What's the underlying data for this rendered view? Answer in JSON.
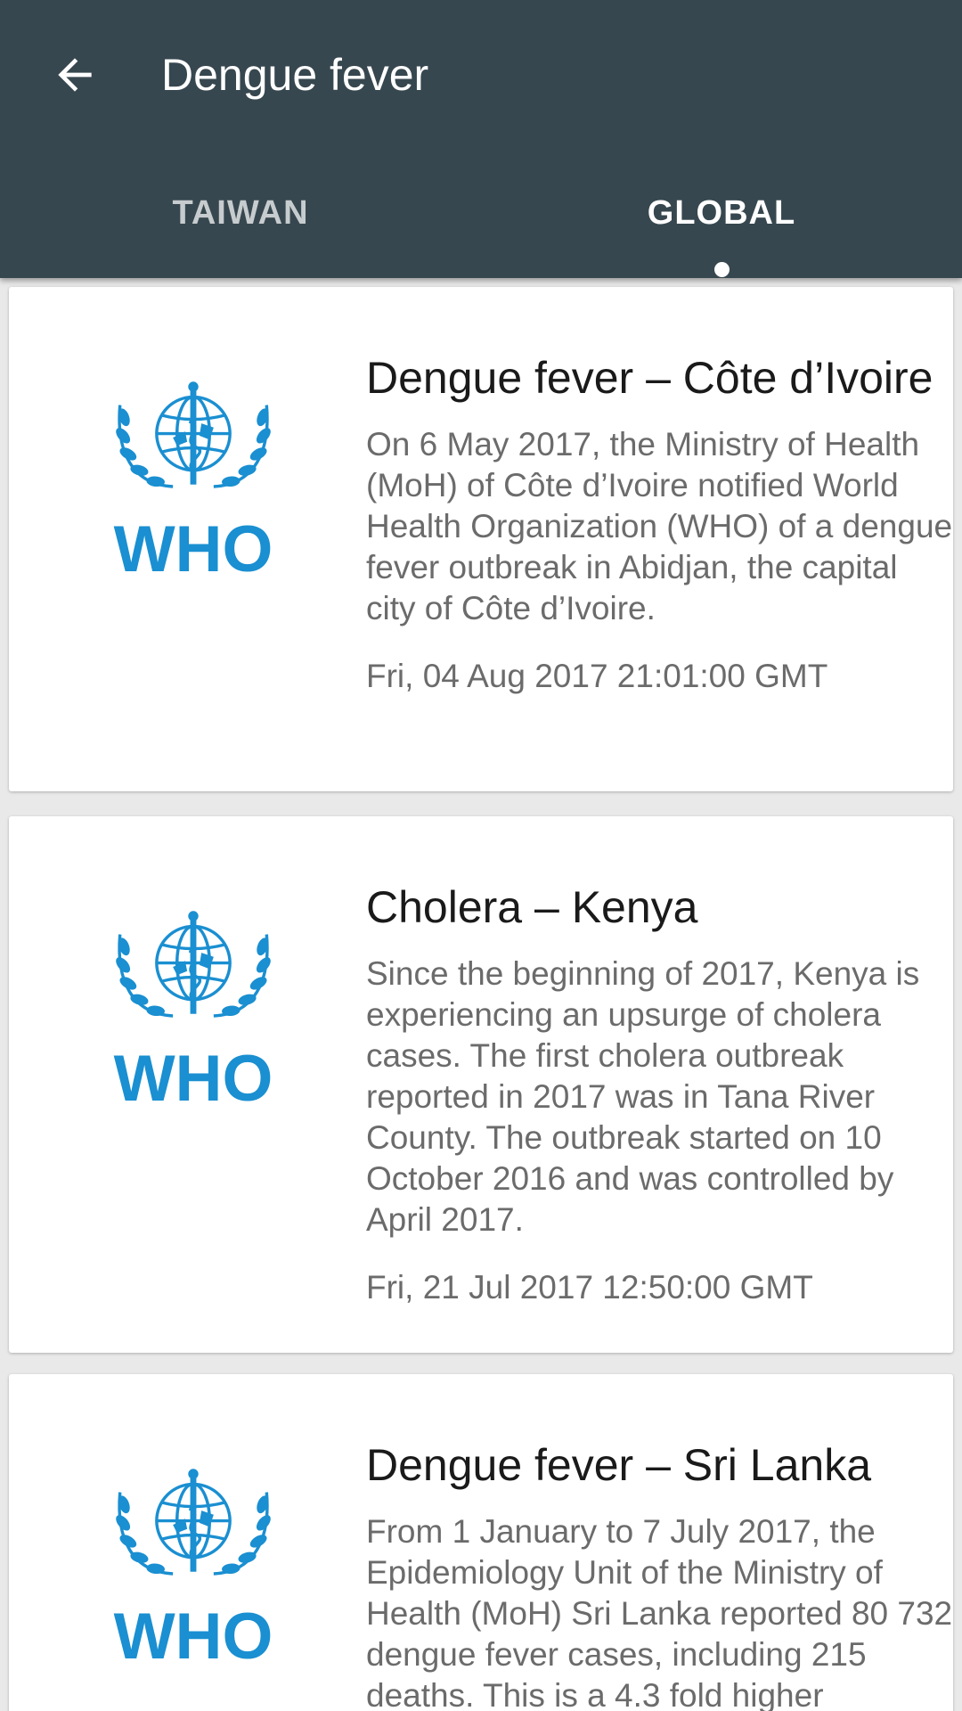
{
  "appbar": {
    "title": "Dengue fever",
    "tabs": [
      {
        "label": "TAIWAN",
        "active": false
      },
      {
        "label": "GLOBAL",
        "active": true
      }
    ]
  },
  "colors": {
    "appbar": "#37474f",
    "who_blue": "#1a8fd1"
  },
  "icons": {
    "back": "arrow-back-icon",
    "logo": "who-logo"
  },
  "logo_text": "WHO",
  "cards": [
    {
      "title": "Dengue fever – Côte d’Ivoire",
      "body": "On 6 May 2017, the Ministry of Health (MoH) of Côte d’Ivoire notified World Health Organization (WHO) of a dengue fever outbreak in Abidjan, the capital city of Côte d’Ivoire.",
      "date": "Fri, 04 Aug 2017 21:01:00 GMT"
    },
    {
      "title": "Cholera – Kenya",
      "body": "Since the beginning of 2017, Kenya is experiencing an upsurge of cholera cases. The first cholera outbreak reported in 2017 was in Tana River County. The outbreak started on 10 October 2016 and was controlled by April 2017.",
      "date": "Fri, 21 Jul 2017 12:50:00 GMT"
    },
    {
      "title": "Dengue fever – Sri Lanka",
      "body": "From 1 January to 7 July 2017, the Epidemiology Unit of the Ministry of Health (MoH) Sri Lanka reported 80 732 dengue fever cases, including 215 deaths. This is a 4.3 fold higher",
      "date": ""
    }
  ]
}
